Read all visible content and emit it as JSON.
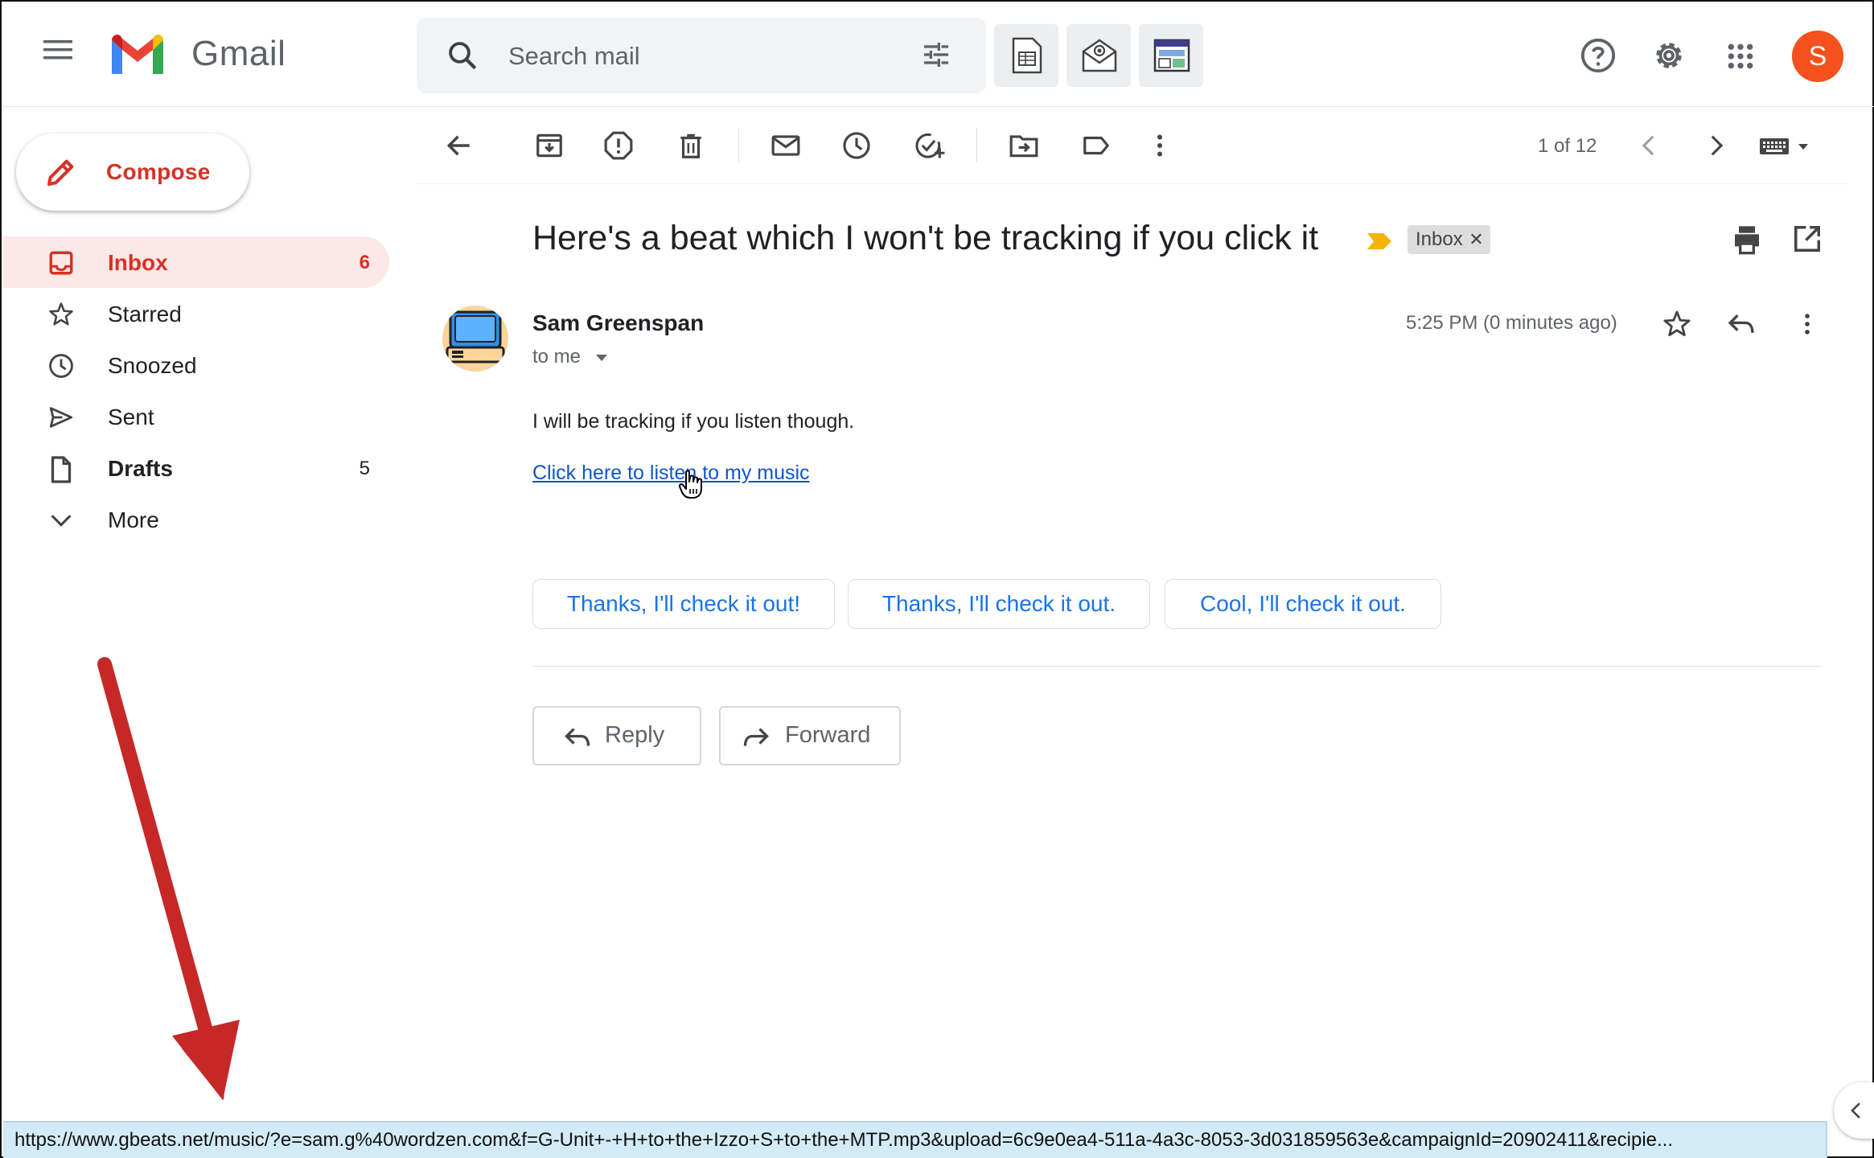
{
  "header": {
    "app_name": "Gmail",
    "search_placeholder": "Search mail",
    "avatar_initial": "S"
  },
  "sidebar": {
    "compose_label": "Compose",
    "items": [
      {
        "label": "Inbox",
        "count": "6"
      },
      {
        "label": "Starred",
        "count": ""
      },
      {
        "label": "Snoozed",
        "count": ""
      },
      {
        "label": "Sent",
        "count": ""
      },
      {
        "label": "Drafts",
        "count": "5"
      },
      {
        "label": "More",
        "count": ""
      }
    ]
  },
  "toolbar": {
    "page_count": "1 of 12"
  },
  "email": {
    "subject": "Here's a beat which I won't be tracking if you click it",
    "label_chip": "Inbox",
    "sender": "Sam Greenspan",
    "recipient": "to me",
    "time": "5:25 PM (0 minutes ago)",
    "body_line": "I will be tracking if you listen though.",
    "link_text": "Click here to listen to my music"
  },
  "smart_replies": [
    "Thanks, I'll check it out!",
    "Thanks, I'll check it out.",
    "Cool, I'll check it out."
  ],
  "actions": {
    "reply": "Reply",
    "forward": "Forward"
  },
  "status_bar": {
    "url": "https://www.gbeats.net/music/?e=sam.g%40wordzen.com&f=G-Unit+-+H+to+the+Izzo+S+to+the+MTP.mp3&upload=6c9e0ea4-511a-4a3c-8053-3d031859563e&campaignId=20902411&recipie..."
  },
  "colors": {
    "accent_red": "#d93025",
    "link_blue": "#1155cc",
    "smart_reply_blue": "#1a73e8",
    "avatar_orange": "#f4511e",
    "annotation_arrow": "#c62828",
    "status_bar_bg": "#d3ebf7"
  },
  "icons": [
    "menu-icon",
    "gmail-logo",
    "search-icon",
    "tune-icon",
    "sheets-addon-icon",
    "mail-addon-icon",
    "layout-addon-icon",
    "help-icon",
    "gear-icon",
    "apps-icon",
    "pencil-icon",
    "inbox-icon",
    "star-icon",
    "clock-icon",
    "send-icon",
    "draft-icon",
    "chevron-down-icon",
    "back-arrow-icon",
    "archive-icon",
    "report-spam-icon",
    "trash-icon",
    "mark-unread-icon",
    "snooze-icon",
    "add-task-icon",
    "move-to-icon",
    "label-icon",
    "more-vert-icon",
    "chevron-left-icon",
    "chevron-right-icon",
    "keyboard-icon",
    "importance-marker-icon",
    "print-icon",
    "open-new-window-icon",
    "reply-icon",
    "forward-icon",
    "hand-cursor-icon",
    "annotation-arrow",
    "collapse-panel-icon"
  ]
}
